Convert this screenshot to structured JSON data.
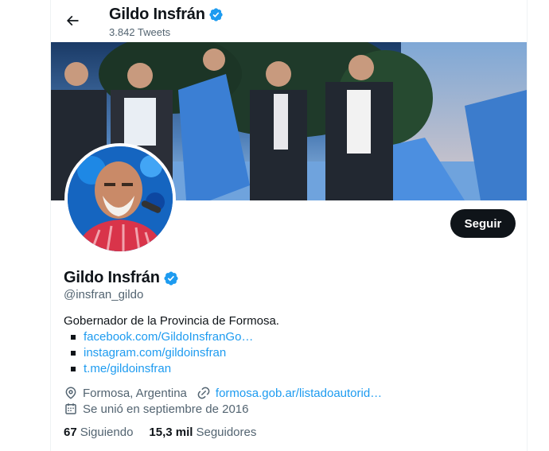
{
  "header": {
    "name": "Gildo Insfrán",
    "tweets_count": "3.842 Tweets"
  },
  "profile": {
    "name": "Gildo Insfrán",
    "handle": "@insfran_gildo",
    "follow_label": "Seguir",
    "bio": "Gobernador de la Provincia de Formosa.",
    "bio_links": [
      "facebook.com/GildoInsfranGo…",
      "instagram.com/gildoinsfran",
      "t.me/gildoinsfran"
    ],
    "location": "Formosa, Argentina",
    "website": "formosa.gob.ar/listadoautorid…",
    "joined": "Se unió en septiembre de 2016"
  },
  "stats": {
    "following_count": "67",
    "following_label": "Siguiendo",
    "followers_count": "15,3 mil",
    "followers_label": "Seguidores"
  },
  "icons": {
    "back": "arrow-left-icon",
    "verified": "verified-badge-icon",
    "location": "location-pin-icon",
    "website": "link-icon",
    "joined": "calendar-icon"
  },
  "colors": {
    "accent": "#1d9bf0",
    "text": "#0f1419",
    "secondary": "#536471",
    "button": "#0f1419"
  }
}
